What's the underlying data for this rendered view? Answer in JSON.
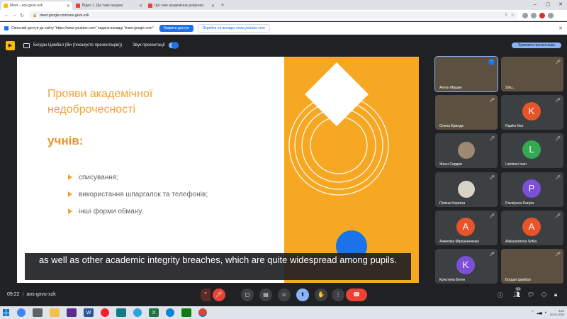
{
  "browser": {
    "tabs": [
      {
        "label": "Meet – aos-gxvu-xzk",
        "color": "#fbbc04",
        "active": true
      },
      {
        "label": "Відео 1. Що таке академ",
        "color": "#ea4335",
        "active": false
      },
      {
        "label": "Що таке академічна доброчес",
        "color": "#ea4335",
        "active": false
      }
    ],
    "url": "meet.google.com/aos-gxvu-xzk",
    "infobar": {
      "message": "Спільний доступ до сайту \"https://www.youtube.com\" надано вкладці \"meet.google.com\"",
      "stop_label": "Закрити доступ",
      "switch_label": "Перейти на вкладку www.youtube.com"
    }
  },
  "meet": {
    "presenter_label": "Богдан Цимбал (Ви (показуєте презентацію))",
    "sound_label": "Звук презентації",
    "stop_presenting_label": "Зупинити презентацію",
    "meeting_time": "09:22",
    "meeting_code": "aos-gxvu-xzk",
    "participant_count": "17"
  },
  "slide": {
    "title": "Прояви академічної недоброчесності",
    "subtitle": "учнів:",
    "bullets": [
      "списування;",
      "використання шпаргалок та телефонів;",
      "інші форми обману."
    ],
    "colors": {
      "accent": "#f0a234",
      "panel": "#f7a823",
      "dot": "#1a73e8"
    }
  },
  "captions": {
    "text": "as well as other academic integrity breaches, which are quite widespread among pupils."
  },
  "participants": [
    {
      "name": "Антон Машин",
      "initial": "",
      "color": "",
      "kind": "video1"
    },
    {
      "name": "Shlu..",
      "initial": "",
      "color": "",
      "kind": "video2"
    },
    {
      "name": "Олена Бриндa",
      "initial": "",
      "color": "",
      "kind": "video3"
    },
    {
      "name": "Rapike Ihor",
      "initial": "K",
      "color": "#e8542a",
      "kind": "avatar"
    },
    {
      "name": "Жанн Сердюк",
      "initial": "",
      "color": "",
      "kind": "photo"
    },
    {
      "name": "Lantinov Ivan",
      "initial": "L",
      "color": "#34a853",
      "kind": "avatar"
    },
    {
      "name": "Поліна Коратна",
      "initial": "",
      "color": "",
      "kind": "photo"
    },
    {
      "name": "Pavalyuca Danyia",
      "initial": "P",
      "color": "#7b4fd6",
      "kind": "avatar"
    },
    {
      "name": "Анжеліка Мірошниченко",
      "initial": "A",
      "color": "#e8542a",
      "kind": "avatar"
    },
    {
      "name": "Aleksandrova Sofiia",
      "initial": "A",
      "color": "#e8542a",
      "kind": "avatar"
    },
    {
      "name": "Кристина Бегин",
      "initial": "K",
      "color": "#7b4fd6",
      "kind": "avatar"
    },
    {
      "name": "Богдан Цимбал",
      "initial": "",
      "color": "",
      "kind": "video4"
    }
  ],
  "taskbar": {
    "time": "9:22",
    "date": "20.01.2024"
  }
}
